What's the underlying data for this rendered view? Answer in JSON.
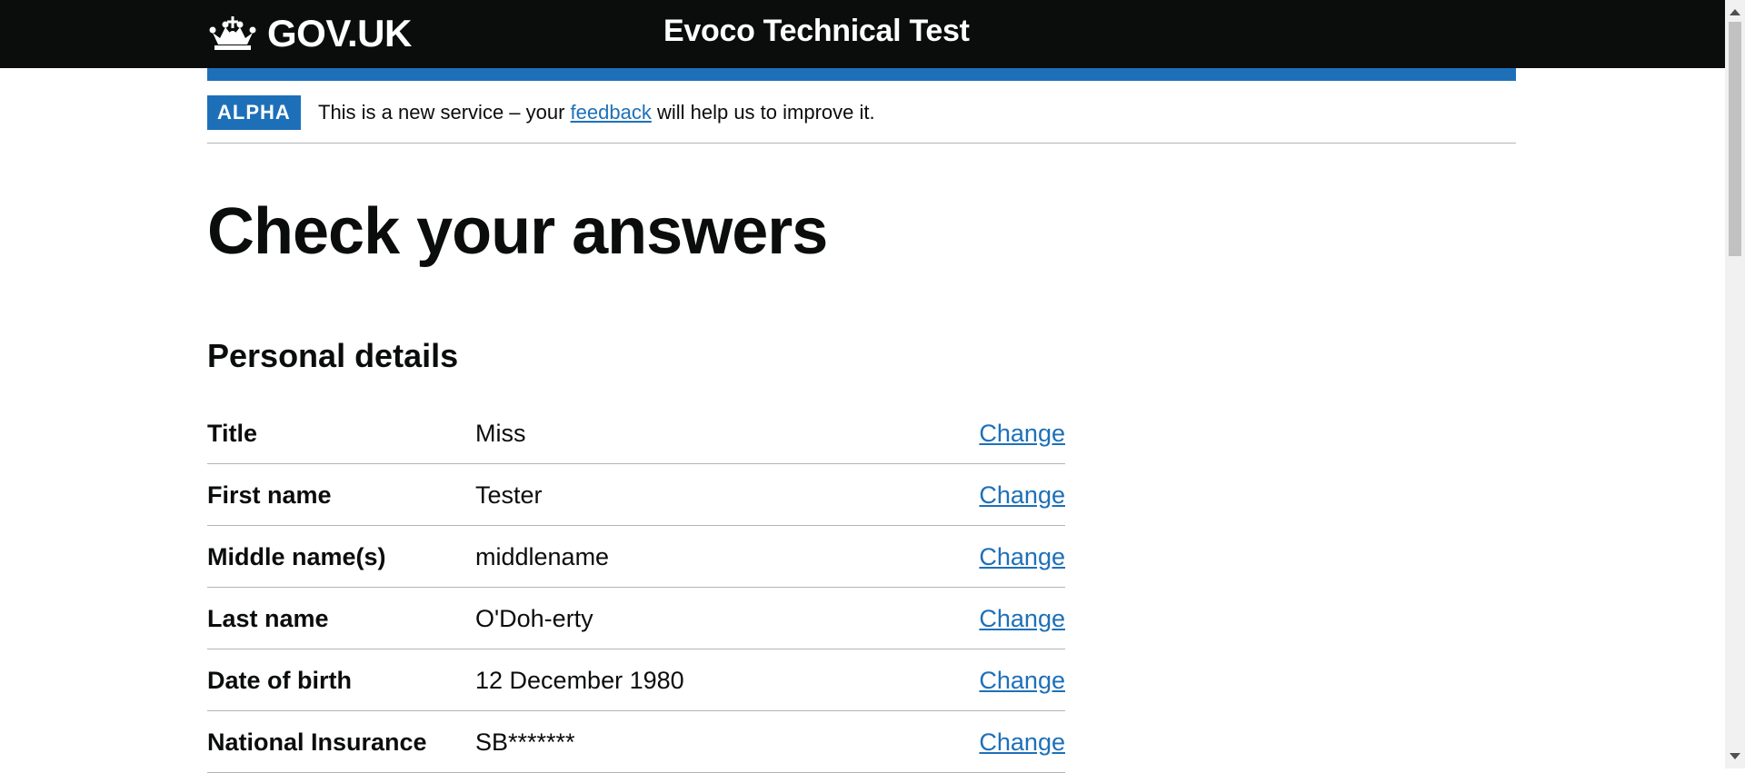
{
  "header": {
    "logo_text": "GOV.UK",
    "service_name": "Evoco Technical Test"
  },
  "phase_banner": {
    "tag": "ALPHA",
    "text_before": "This is a new service – your ",
    "link_text": "feedback",
    "text_after": " will help us to improve it."
  },
  "page": {
    "title": "Check your answers",
    "section_title": "Personal details"
  },
  "summary_rows": [
    {
      "key": "Title",
      "value": "Miss",
      "action": "Change"
    },
    {
      "key": "First name",
      "value": "Tester",
      "action": "Change"
    },
    {
      "key": "Middle name(s)",
      "value": "middlename",
      "action": "Change"
    },
    {
      "key": "Last name",
      "value": "O'Doh-erty",
      "action": "Change"
    },
    {
      "key": "Date of birth",
      "value": "12 December 1980",
      "action": "Change"
    },
    {
      "key": "National Insurance",
      "value": "SB*******",
      "action": "Change"
    }
  ],
  "colors": {
    "header_bg": "#0b0c0c",
    "brand_blue": "#1d70b8",
    "text": "#0b0c0c",
    "border": "#b1b4b6"
  },
  "icons": {
    "logo": "crown-icon"
  }
}
